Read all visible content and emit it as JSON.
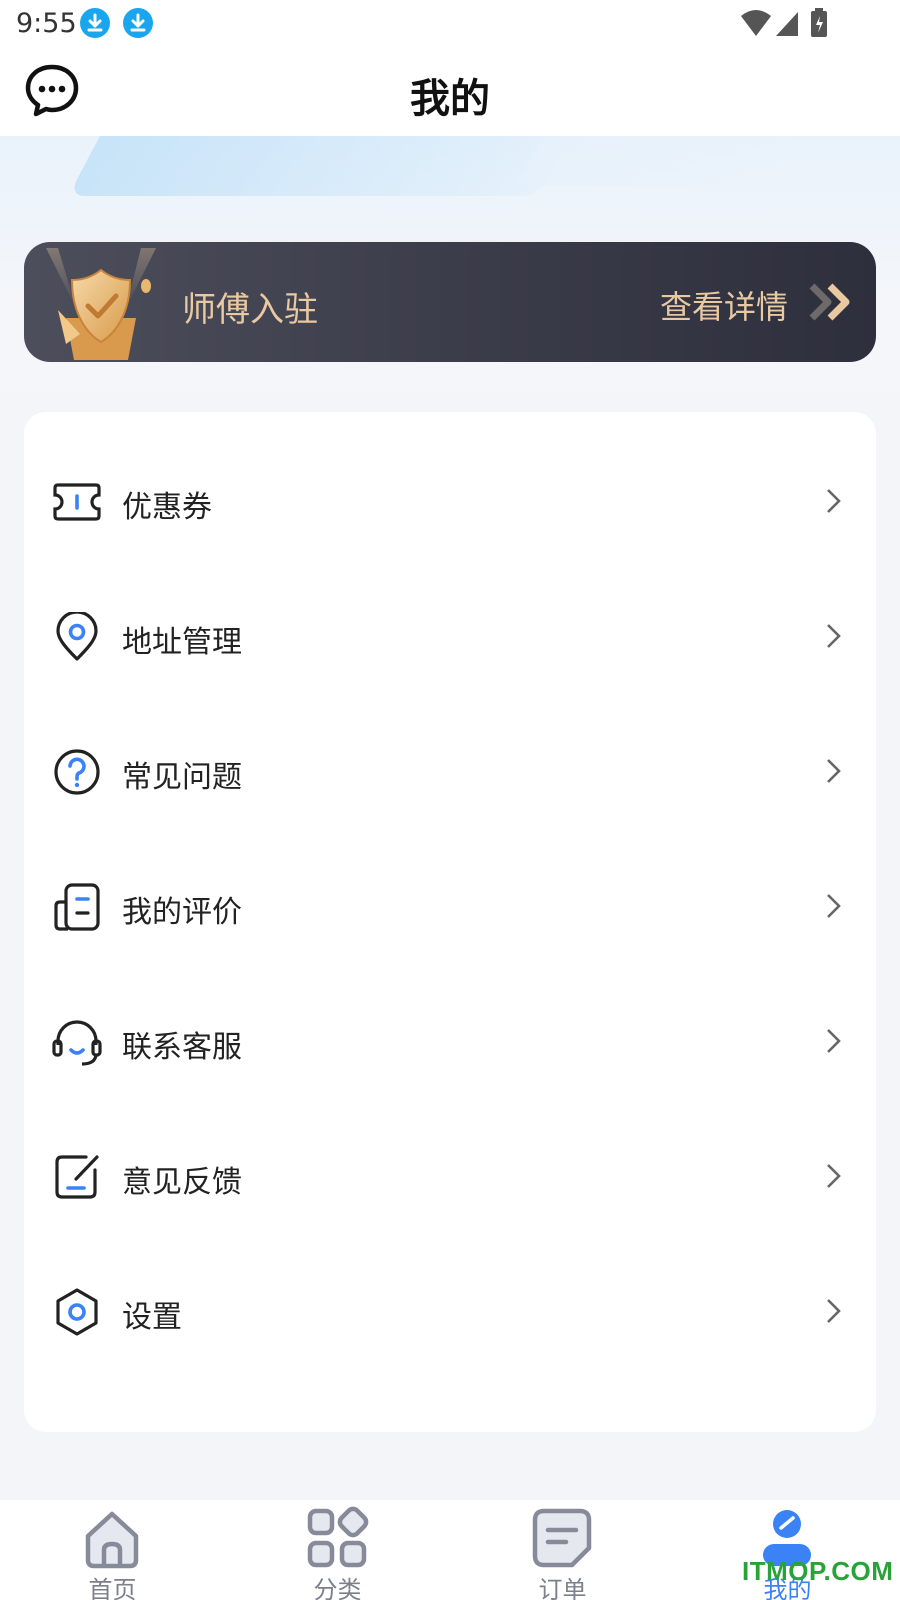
{
  "status_bar": {
    "time": "9:55"
  },
  "header": {
    "title": "我的",
    "message_icon": "chat-bubble-icon"
  },
  "banner": {
    "title": "师傅入驻",
    "link_label": "查看详情",
    "text_color": "#e8c9a2",
    "bg_color": "#3c3d4b"
  },
  "menu": {
    "items": [
      {
        "label": "优惠券",
        "icon": "coupon-icon"
      },
      {
        "label": "地址管理",
        "icon": "location-pin-icon"
      },
      {
        "label": "常见问题",
        "icon": "question-icon"
      },
      {
        "label": "我的评价",
        "icon": "review-icon"
      },
      {
        "label": "联系客服",
        "icon": "headset-icon"
      },
      {
        "label": "意见反馈",
        "icon": "edit-feedback-icon"
      },
      {
        "label": "设置",
        "icon": "settings-hexagon-icon"
      }
    ]
  },
  "tab_bar": {
    "active": 3,
    "active_color": "#3b82f6",
    "tabs": [
      {
        "label": "首页",
        "icon": "home-icon"
      },
      {
        "label": "分类",
        "icon": "category-grid-icon"
      },
      {
        "label": "订单",
        "icon": "order-icon"
      },
      {
        "label": "我的",
        "icon": "profile-icon"
      }
    ]
  },
  "watermark": "ITMOP.COM",
  "accent_color": "#3b82f6"
}
